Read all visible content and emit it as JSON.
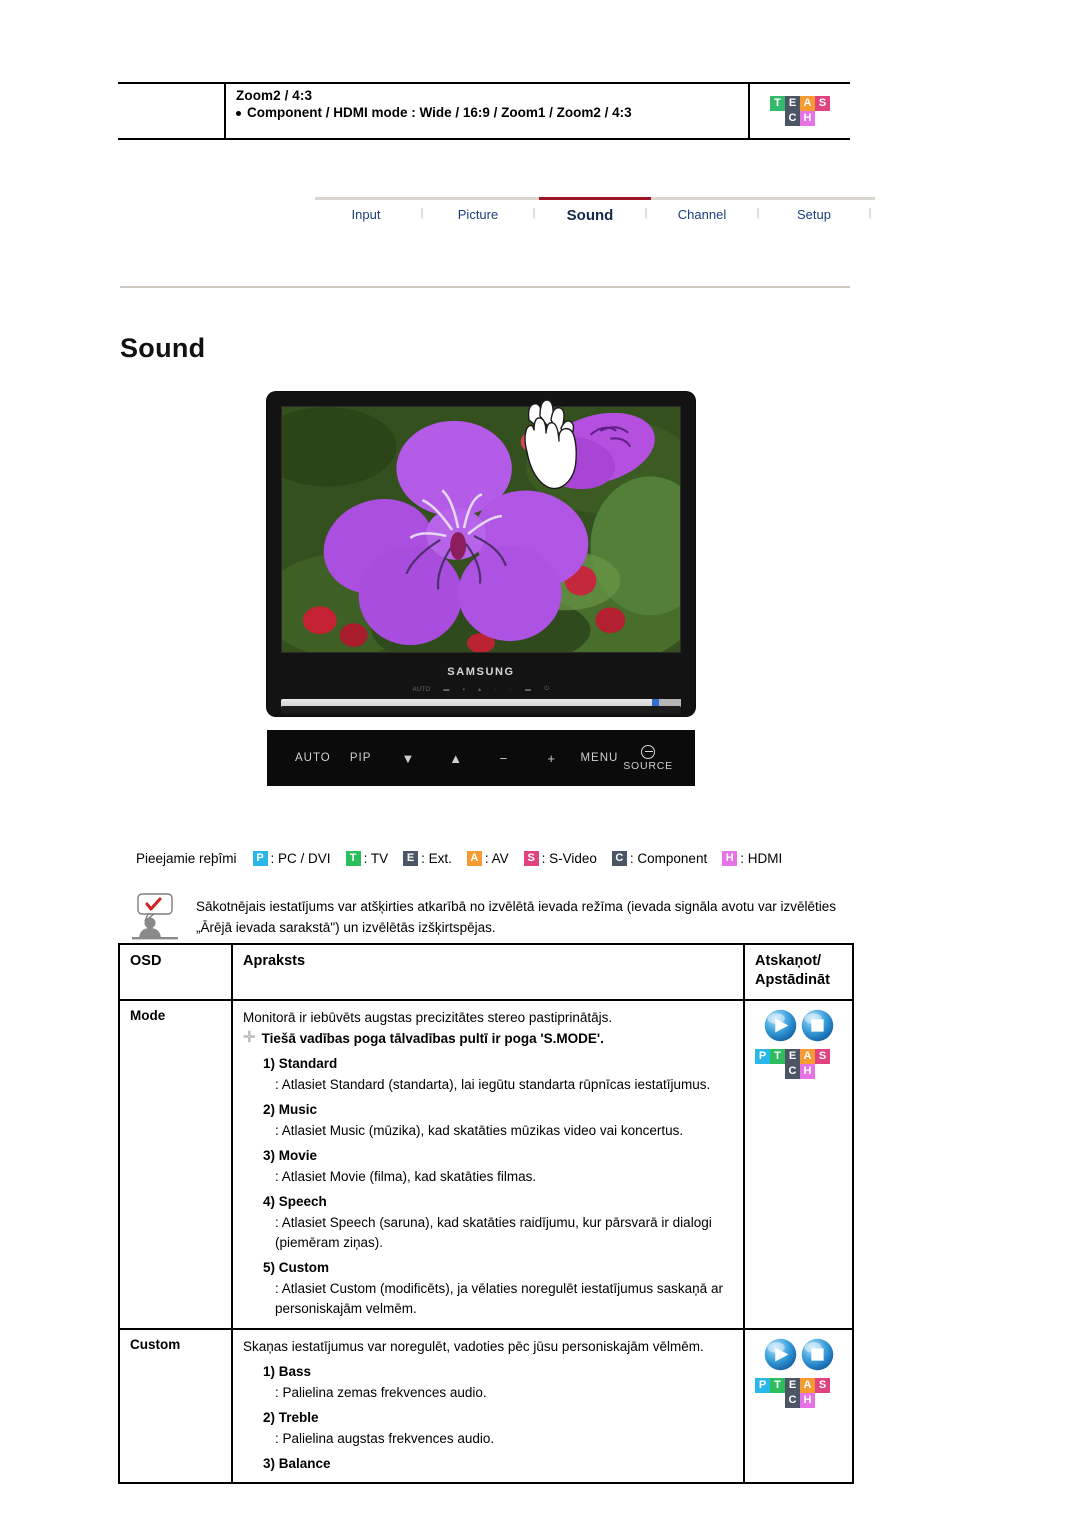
{
  "breadcrumb": {
    "line1": "Zoom2 / 4:3",
    "line2": "Component / HDMI mode : Wide / 16:9 / Zoom1 / Zoom2 / 4:3"
  },
  "logo": {
    "row1": [
      {
        "letter": "T",
        "color": "#35b96a"
      },
      {
        "letter": "E",
        "color": "#4b5566"
      },
      {
        "letter": "A",
        "color": "#f59b32"
      },
      {
        "letter": "S",
        "color": "#e0437f"
      }
    ],
    "row2": [
      {
        "letter": "C",
        "color": "#4b5566"
      },
      {
        "letter": "H",
        "color": "#e673e6"
      }
    ]
  },
  "nav": {
    "tabs": [
      {
        "label": "Input",
        "active": false
      },
      {
        "label": "Picture",
        "active": false
      },
      {
        "label": "Sound",
        "active": true
      },
      {
        "label": "Channel",
        "active": false
      },
      {
        "label": "Setup",
        "active": false
      }
    ],
    "separator": "|",
    "active_color": "#9d1522"
  },
  "page_title": "Sound",
  "monitor": {
    "brand": "SAMSUNG",
    "mini_labels": [
      "AUTO",
      "",
      "",
      "",
      "",
      "",
      "",
      ""
    ],
    "controls": [
      {
        "label": "AUTO",
        "type": "text"
      },
      {
        "label": "PIP",
        "type": "text"
      },
      {
        "label": "▼",
        "type": "sym"
      },
      {
        "label": "▲",
        "type": "sym"
      },
      {
        "label": "−",
        "type": "sym"
      },
      {
        "label": "+",
        "type": "sym"
      },
      {
        "label": "MENU",
        "type": "text"
      },
      {
        "label": "SOURCE",
        "type": "source"
      }
    ]
  },
  "legend": {
    "title": "Pieejamie reþîmi",
    "items": [
      {
        "letter": "P",
        "color": "#29b6e8",
        "text": ": PC / DVI"
      },
      {
        "letter": "T",
        "color": "#2bbd5e",
        "text": ": TV"
      },
      {
        "letter": "E",
        "color": "#4b5566",
        "text": ": Ext."
      },
      {
        "letter": "A",
        "color": "#f59b32",
        "text": ": AV"
      },
      {
        "letter": "S",
        "color": "#e0437f",
        "text": ": S-Video"
      },
      {
        "letter": "C",
        "color": "#4b5566",
        "text": ": Component"
      },
      {
        "letter": "H",
        "color": "#e673e6",
        "text": ": HDMI"
      }
    ]
  },
  "note": {
    "text": "Sākotnējais iestatījums var atšķirties atkarībā no izvēlētā ievada režīma (ievada signāla avotu var izvēlēties „Ārējā ievada sarakstā\") un izvēlētās izšķirtspējas."
  },
  "table": {
    "headers": {
      "osd": "OSD",
      "desc": "Apraksts",
      "play_line1": "Atskaņot/",
      "play_line2": "Apstādināt"
    },
    "rows": [
      {
        "osd": "Mode",
        "intro": "Monitorā ir iebūvēts augstas precizitātes stereo pastiprinātājs.",
        "direct": "Tiešā vadības poga tālvadības pultī ir poga 'S.MODE'.",
        "items": [
          {
            "num": "1) Standard",
            "desc": ": Atlasiet Standard (standarta), lai iegūtu standarta rūpnīcas iestatījumus."
          },
          {
            "num": "2) Music",
            "desc": ": Atlasiet Music (mūzika), kad skatāties mūzikas video vai koncertus."
          },
          {
            "num": "3) Movie",
            "desc": ": Atlasiet Movie (filma), kad skatāties filmas."
          },
          {
            "num": "4) Speech",
            "desc": ": Atlasiet Speech (saruna), kad skatāties raidījumu, kur pārsvarā ir dialogi (piemēram ziņas)."
          },
          {
            "num": "5) Custom",
            "desc": ": Atlasiet Custom (modificēts), ja vēlaties noregulēt iestatījumus saskaņā ar personiskajām velmēm."
          }
        ]
      },
      {
        "osd": "Custom",
        "intro": "Skaņas iestatījumus var noregulēt, vadoties pēc jūsu personiskajām vēlmēm.",
        "direct": "",
        "items": [
          {
            "num": "1) Bass",
            "desc": ": Palielina zemas frekvences audio."
          },
          {
            "num": "2) Treble",
            "desc": ": Palielina augstas frekvences audio."
          },
          {
            "num": "3) Balance",
            "desc": ""
          }
        ]
      }
    ],
    "play_badges": {
      "row1": [
        {
          "letter": "P",
          "color": "#29b6e8"
        },
        {
          "letter": "T",
          "color": "#2bbd5e"
        },
        {
          "letter": "E",
          "color": "#4b5566"
        },
        {
          "letter": "A",
          "color": "#f59b32"
        },
        {
          "letter": "S",
          "color": "#e0437f"
        }
      ],
      "row2": [
        {
          "letter": "C",
          "color": "#4b5566"
        },
        {
          "letter": "H",
          "color": "#e673e6"
        }
      ],
      "icons": [
        "play-orb-icon",
        "stop-orb-icon"
      ]
    }
  }
}
